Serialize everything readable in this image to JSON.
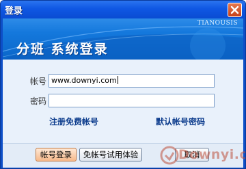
{
  "window": {
    "title": "登录"
  },
  "banner": {
    "brand": "TIANOUSIS",
    "title": "分班  系统登录"
  },
  "form": {
    "account_label": "帐号",
    "account_value": "www.downyi.com",
    "password_label": "密码",
    "password_value": ""
  },
  "links": {
    "register": "注册免费帐号",
    "default_account": "默认帐号密码"
  },
  "buttons": {
    "login": "帐号登录",
    "trial": "免帐号试用体验",
    "cancel": "取消"
  },
  "watermark": {
    "text": "Downyi.com"
  },
  "colors": {
    "titlebar": "#0f57e3",
    "panel": "#e9f1fb",
    "link": "#0b3b8c",
    "primary_button": "#f6b88a"
  }
}
